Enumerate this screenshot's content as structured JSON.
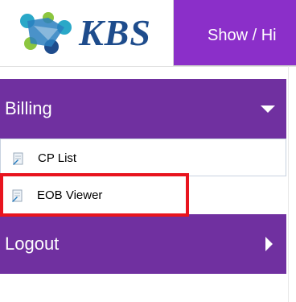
{
  "header": {
    "logo_text": "KBS",
    "show_hide_label": "Show / Hi"
  },
  "sidebar": {
    "billing": {
      "label": "Billing"
    },
    "items": [
      {
        "label": "CP List",
        "icon": "document-icon"
      },
      {
        "label": "EOB Viewer",
        "icon": "document-icon"
      }
    ],
    "logout": {
      "label": "Logout"
    }
  },
  "colors": {
    "accent_purple": "#7030a0",
    "header_purple": "#8b2fc9",
    "logo_blue": "#1e4c8c",
    "highlight_red": "#e8141e"
  }
}
